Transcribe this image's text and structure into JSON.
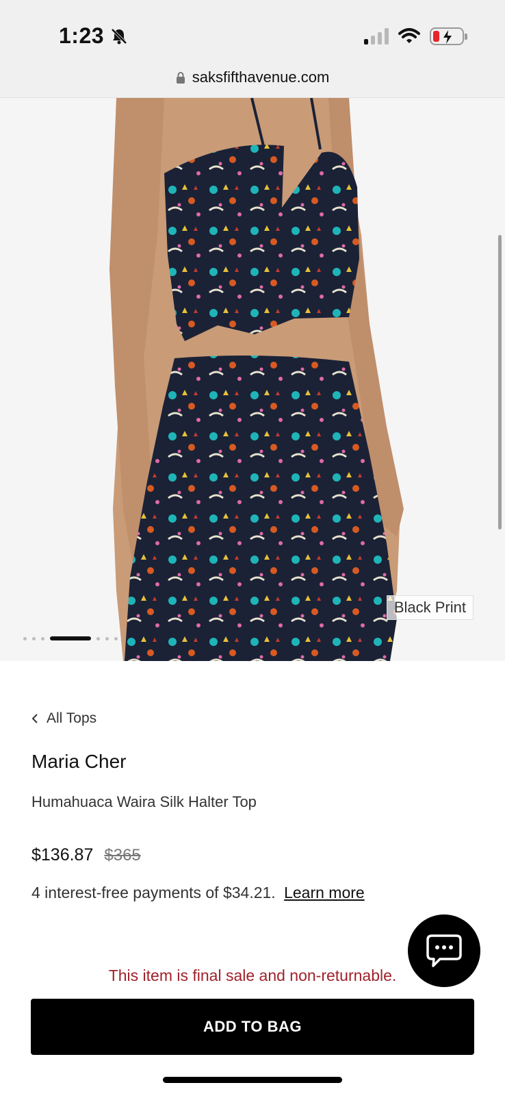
{
  "status_bar": {
    "time": "1:23",
    "icons": [
      "bell-slash-icon",
      "signal-icon",
      "wifi-icon",
      "battery-charging-icon"
    ]
  },
  "browser": {
    "url": "saksfifthavenue.com",
    "lock_icon": "lock-icon"
  },
  "gallery": {
    "color_label": "Black Print",
    "image_index": 4,
    "image_count": 9
  },
  "product": {
    "back_link": "All Tops",
    "brand": "Maria Cher",
    "name": "Humahuaca Waira Silk Halter Top",
    "price": "$136.87",
    "original_price": "$365",
    "installments_text": "4 interest-free payments of $34.21.",
    "learn_more": "Learn more"
  },
  "notice": {
    "final_sale": "This item is final sale and non-returnable."
  },
  "actions": {
    "add_to_bag": "ADD TO BAG",
    "chat_icon": "chat-bubble-icon"
  },
  "colors": {
    "final_sale_text": "#a0212a",
    "button_bg": "#000000",
    "chrome_bg": "#f0f0f0"
  }
}
